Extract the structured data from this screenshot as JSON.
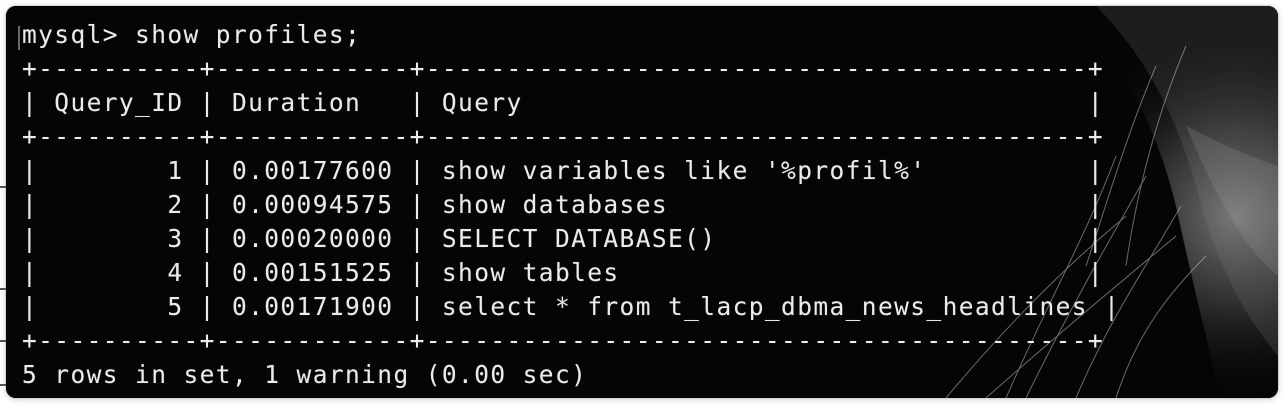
{
  "terminal": {
    "prompt": "mysql> show profiles;",
    "border_line": "+----------+------------+-----------------------------------------+",
    "header_line": "| Query_ID | Duration   | Query                                   |",
    "rows": [
      "|        1 | 0.00177600 | show variables like '%profil%'          |",
      "|        2 | 0.00094575 | show databases                          |",
      "|        3 | 0.00020000 | SELECT DATABASE()                       |",
      "|        4 | 0.00151525 | show tables                             |",
      "|        5 | 0.00171900 | select * from t_lacp_dbma_news_headlines |"
    ],
    "footer": "5 rows in set, 1 warning (0.00 sec)"
  },
  "table": {
    "columns": [
      "Query_ID",
      "Duration",
      "Query"
    ],
    "rows": [
      [
        "1",
        "0.00177600",
        "show variables like '%profil%'"
      ],
      [
        "2",
        "0.00094575",
        "show databases"
      ],
      [
        "3",
        "0.00020000",
        "SELECT DATABASE()"
      ],
      [
        "4",
        "0.00151525",
        "show tables"
      ],
      [
        "5",
        "0.00171900",
        "select * from t_lacp_dbma_news_headlines"
      ]
    ]
  },
  "colors": {
    "background": "#050505",
    "text": "#ebebeb"
  }
}
